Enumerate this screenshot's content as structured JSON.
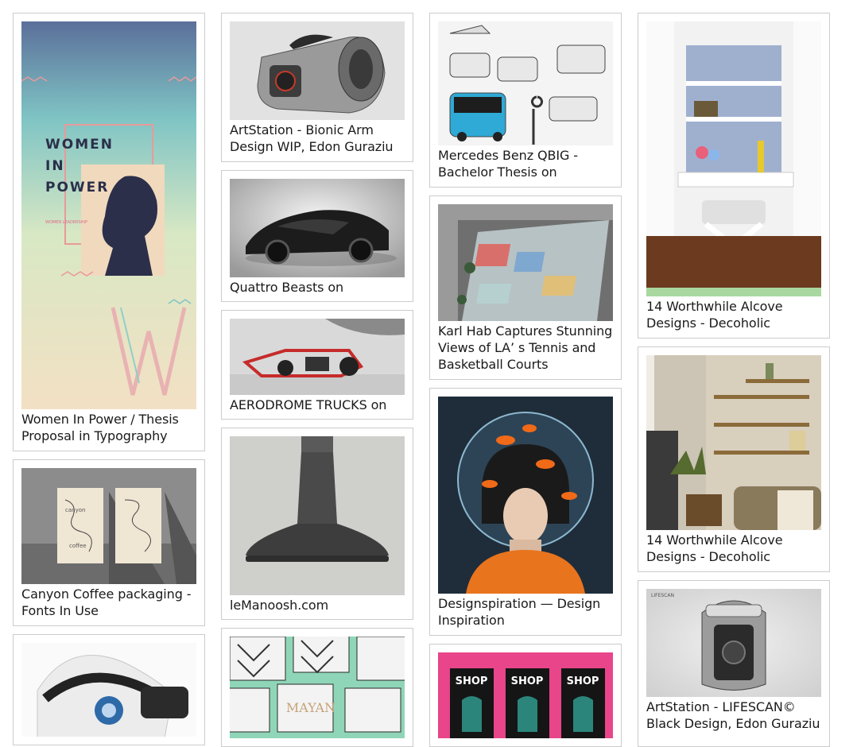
{
  "pins": [
    {
      "caption": "Women In Power / Thesis Proposal in Typography",
      "poster_title": "WOMEN IN POWER",
      "poster_subtitle": "WOMEN LEADERSHIP"
    },
    {
      "caption": "Canyon Coffee packaging - Fonts In Use",
      "bag_brand": "canyon",
      "bag_label": "coffee"
    },
    {
      "caption": ""
    },
    {
      "caption": "ArtStation - Bionic Arm Design WIP, Edon Guraziu"
    },
    {
      "caption": "Quattro Beasts on"
    },
    {
      "caption": "AERODROME TRUCKS on"
    },
    {
      "caption": "leManoosh.com"
    },
    {
      "caption": "",
      "card_text": "MAYAN"
    },
    {
      "caption": "Mercedes Benz QBIG - Bachelor Thesis on"
    },
    {
      "caption": "Karl Hab Captures Stunning Views of LA’ s Tennis and Basketball Courts"
    },
    {
      "caption": "Designspiration — Design Inspiration"
    },
    {
      "caption": "",
      "shop_label": "SHOP"
    },
    {
      "caption": "14 Worthwhile Alcove Designs - Decoholic"
    },
    {
      "caption": "14 Worthwhile Alcove Designs - Decoholic"
    },
    {
      "caption": "ArtStation - LIFESCAN© Black Design, Edon Guraziu",
      "thumb_brand": "LIFESCAN"
    }
  ]
}
